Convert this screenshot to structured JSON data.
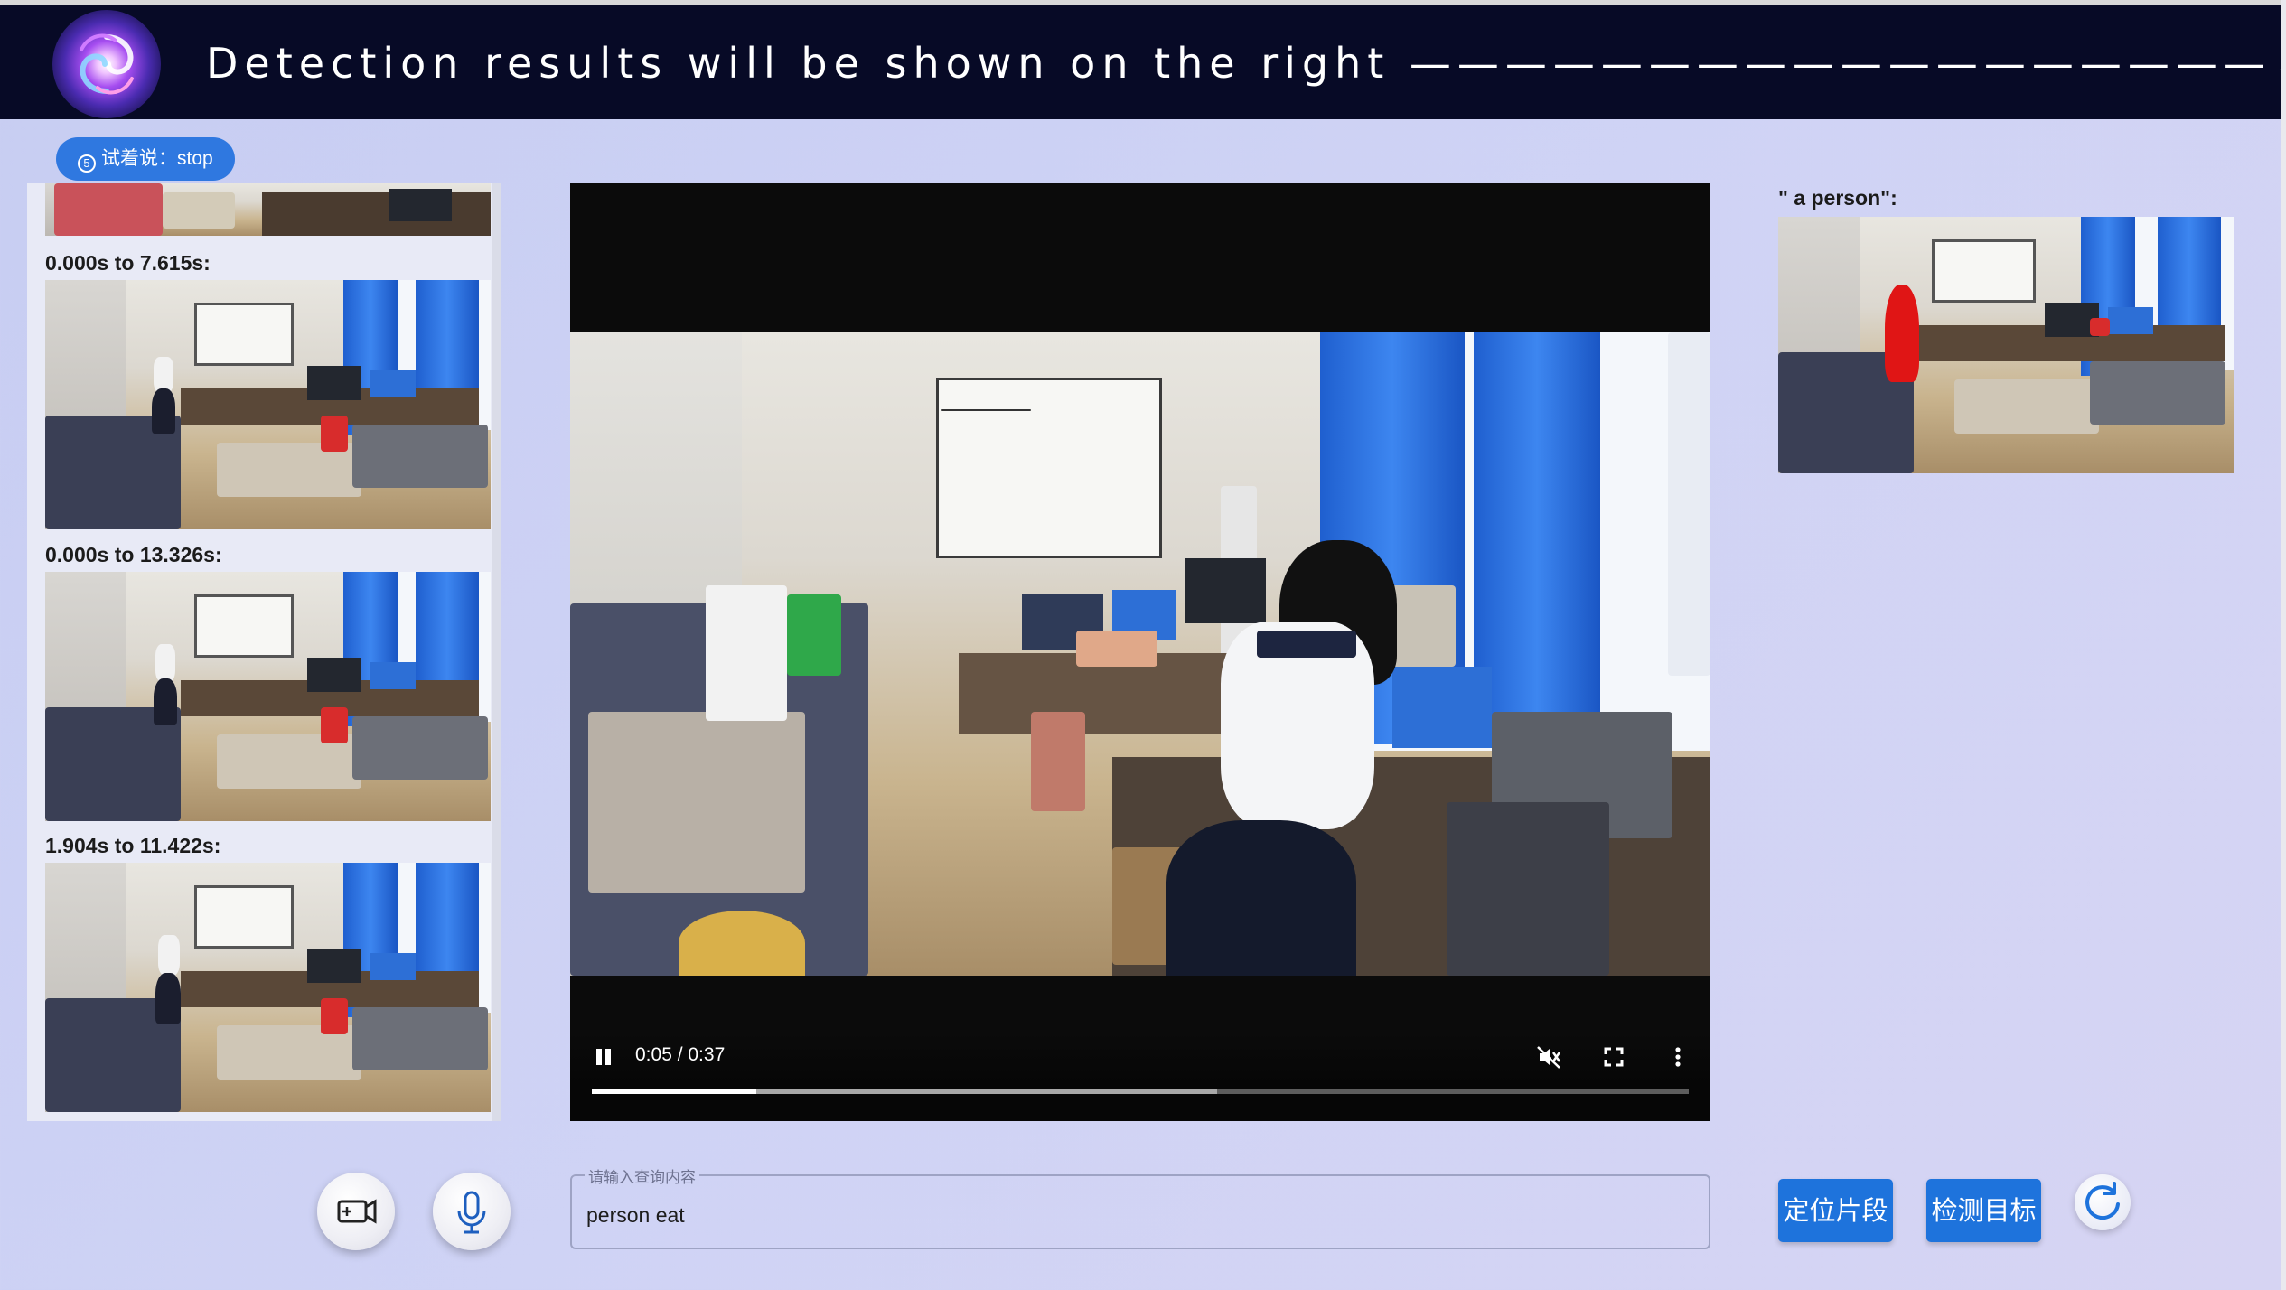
{
  "header": {
    "title": "Detection results will be shown on the right ——————————————————↓",
    "logo_icon": "swirl-logo-icon"
  },
  "hint": {
    "icon": "counter-5-icon",
    "icon_text": "5",
    "text": "试着说：stop"
  },
  "segments": [
    {
      "label": "0.000s to 7.615s:"
    },
    {
      "label": "0.000s to 13.326s:"
    },
    {
      "label": "1.904s to 11.422s:"
    }
  ],
  "player": {
    "time": "0:05 / 0:37",
    "played_fraction": 0.15,
    "buffered_fraction": 0.57,
    "state": "playing",
    "muted": true
  },
  "detection": {
    "label": "\" a person\":",
    "highlight_color": "#e01515"
  },
  "query": {
    "legend": "请输入查询内容",
    "value": "person eat"
  },
  "buttons": {
    "locate_label": "定位片段",
    "detect_label": "检测目标"
  },
  "colors": {
    "header_bg": "#070a26",
    "accent": "#1e73dc",
    "page_bg": "#cfd3f4"
  }
}
